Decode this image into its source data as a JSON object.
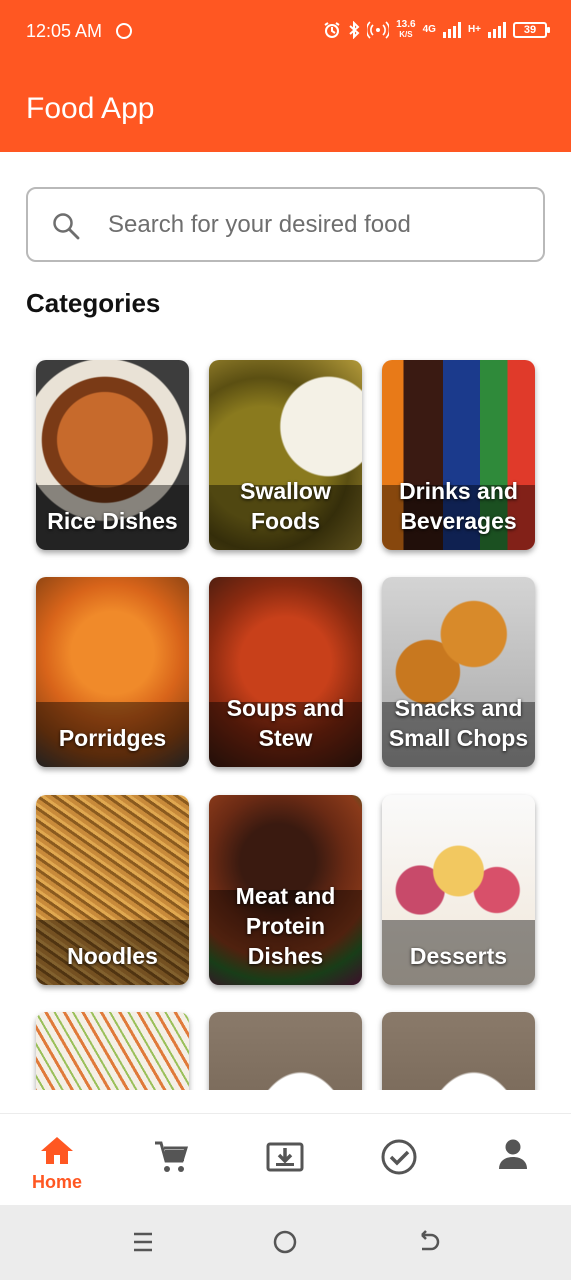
{
  "status_bar": {
    "time": "12:05 AM",
    "net_speed_value": "13.6",
    "net_speed_unit": "K/S",
    "network_type_1": "4G",
    "network_type_2": "H+",
    "battery": "39"
  },
  "app_bar": {
    "title": "Food App"
  },
  "search": {
    "placeholder": "Search for your desired food"
  },
  "categories": {
    "title": "Categories",
    "items": [
      {
        "label_1": "Rice Dishes",
        "label_2": ""
      },
      {
        "label_1": "Swallow",
        "label_2": "Foods"
      },
      {
        "label_1": "Drinks and",
        "label_2": "Beverages"
      },
      {
        "label_1": "Porridges",
        "label_2": ""
      },
      {
        "label_1": "Soups and",
        "label_2": "Stew"
      },
      {
        "label_1": "Snacks and",
        "label_2": "Small Chops"
      },
      {
        "label_1": "Meat and",
        "label_2": "Protein"
      },
      {
        "label_1": "Noodles",
        "label_2": ""
      },
      {
        "label_1": "Desserts",
        "label_2": ""
      },
      {
        "label_3": "Dishes"
      }
    ]
  },
  "bottom_nav": {
    "home_label": "Home",
    "active_color": "#ff5722",
    "inactive_color": "#555555",
    "icons": [
      "home-icon",
      "cart-icon",
      "download-icon",
      "check-circle-icon",
      "person-icon"
    ]
  },
  "colors": {
    "primary": "#ff5722"
  }
}
